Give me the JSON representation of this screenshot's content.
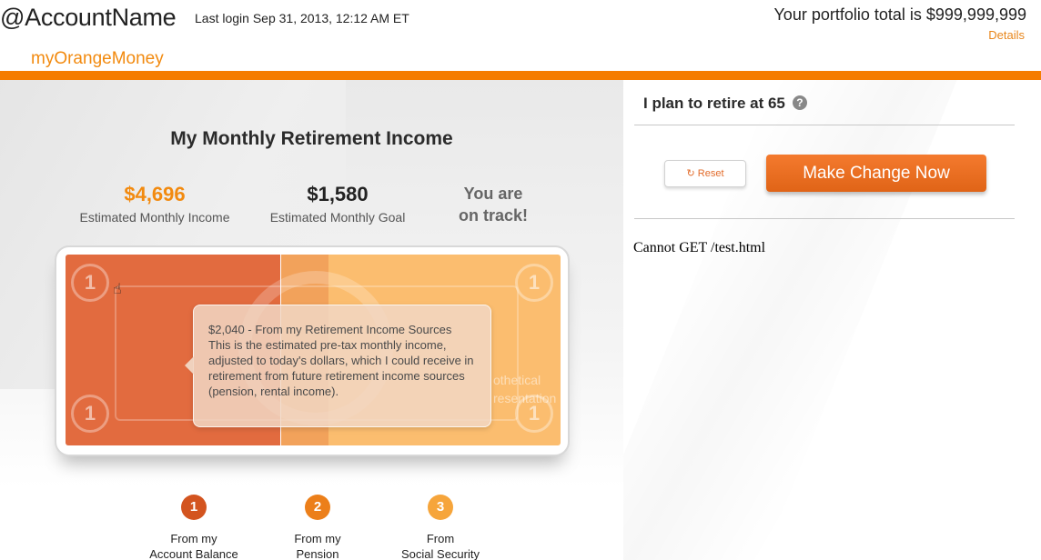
{
  "header": {
    "account_name": "@AccountName",
    "last_login": "Last login Sep 31, 2013, 12:12 AM ET",
    "portfolio_total": "Your portfolio total is $999,999,999",
    "details_link": "Details",
    "brand": "myOrangeMoney",
    "accent_color": "#f57c00"
  },
  "income_panel": {
    "title": "My Monthly Retirement Income",
    "estimated_income": {
      "value": "$4,696",
      "label": "Estimated Monthly Income"
    },
    "estimated_goal": {
      "value": "$1,580",
      "label": "Estimated Monthly Goal"
    },
    "status_line1": "You are",
    "status_line2": "on track!",
    "bill": {
      "coin_symbol": "1",
      "watermark_line1": "othetical",
      "watermark_line2": "resentation",
      "tooltip_title": "$2,040 - From my Retirement Income Sources",
      "tooltip_body": "This is the estimated pre-tax monthly income, adjusted to today's dollars, which I could receive in retirement from future retirement income sources (pension, rental income)."
    },
    "markers": [
      {
        "number": "1",
        "line1": "From my",
        "line2": "Account Balance",
        "color": "#d3541f"
      },
      {
        "number": "2",
        "line1": "From my",
        "line2": "Pension",
        "color": "#ec7f1a"
      },
      {
        "number": "3",
        "line1": "From",
        "line2": "Social Security",
        "color": "#f6a53b"
      }
    ]
  },
  "plan_panel": {
    "retire_text": "I plan to retire at 65",
    "help_icon": "?",
    "reset_label": "Reset",
    "reset_icon": "↻",
    "make_change_label": "Make Change Now",
    "error_message": "Cannot GET /test.html"
  }
}
